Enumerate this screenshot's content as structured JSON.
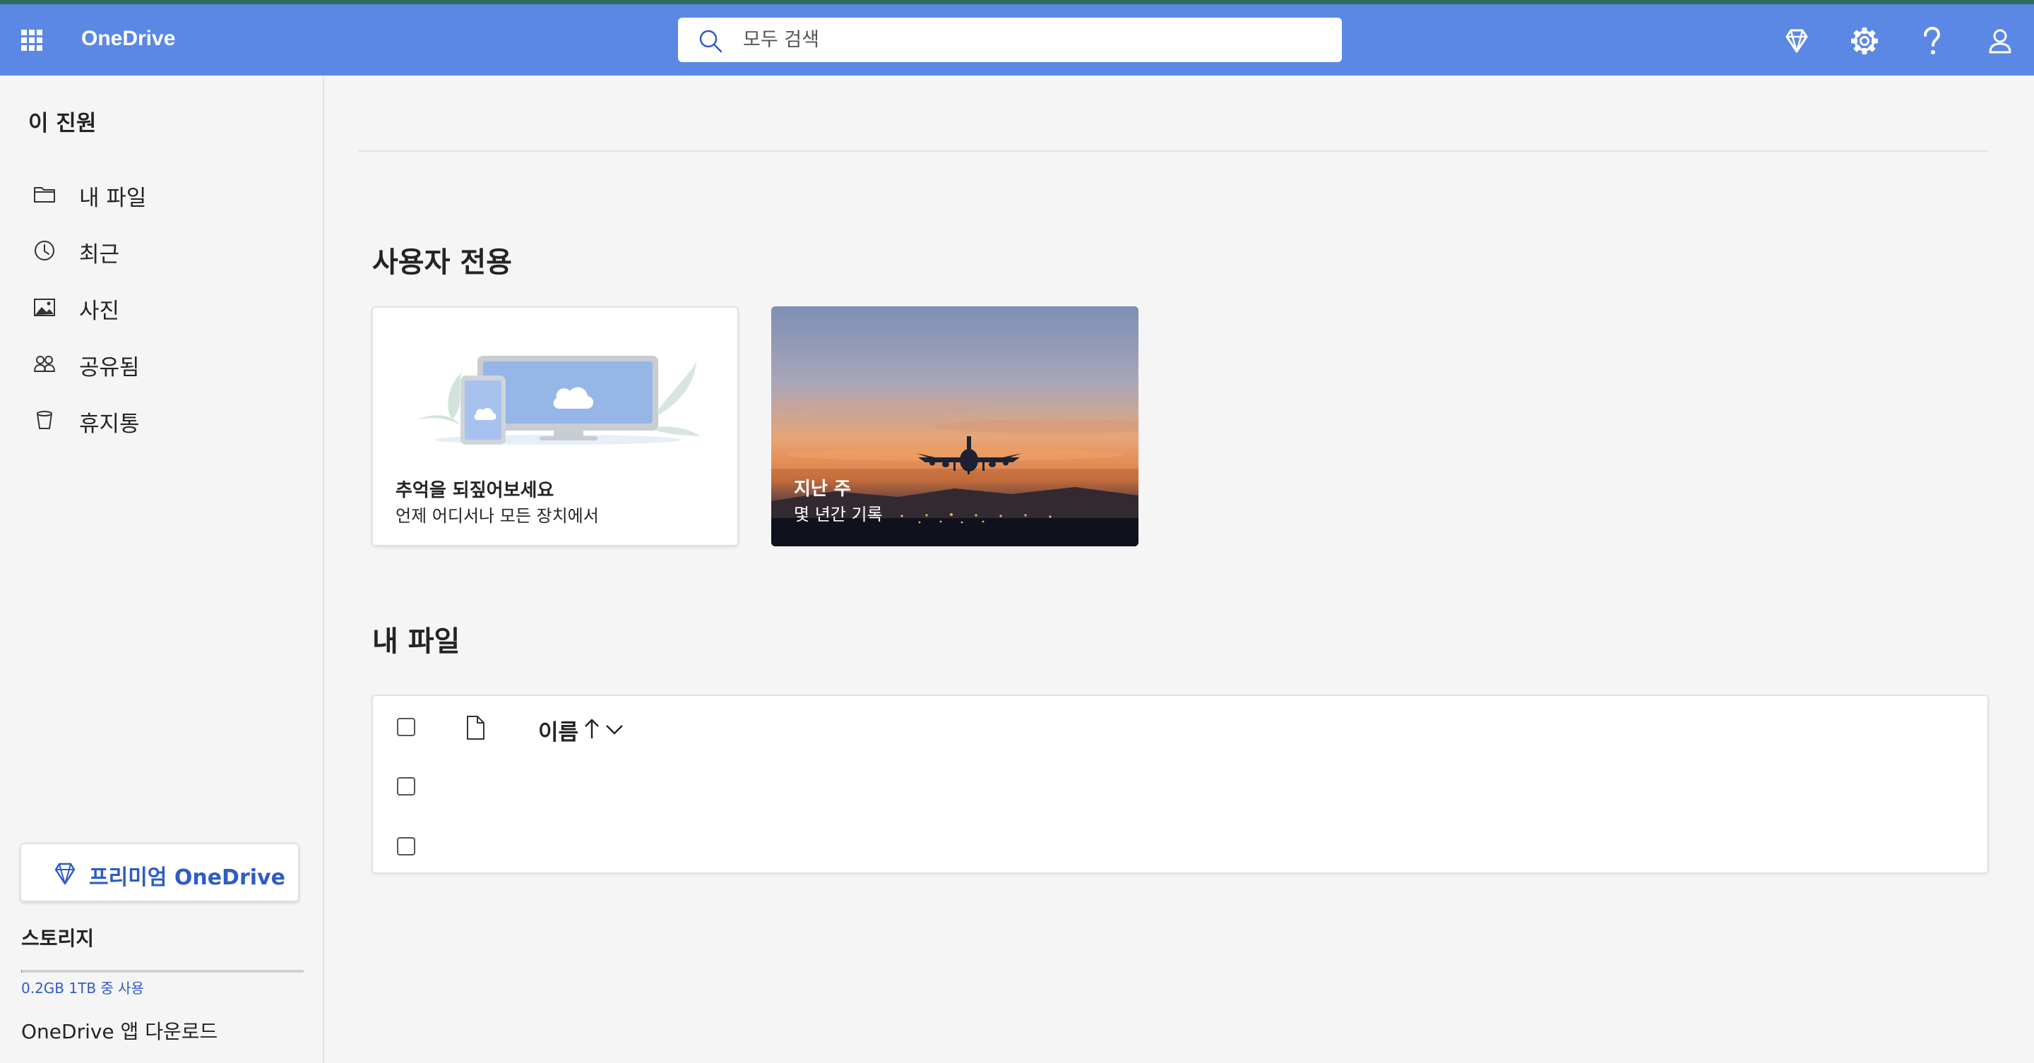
{
  "app": {
    "brand": "OneDrive"
  },
  "search": {
    "placeholder": "모두 검색"
  },
  "sidebar": {
    "user_name": "이 진원",
    "items": [
      {
        "label": "내 파일",
        "icon": "folder-icon"
      },
      {
        "label": "최근",
        "icon": "clock-icon"
      },
      {
        "label": "사진",
        "icon": "image-icon"
      },
      {
        "label": "공유됨",
        "icon": "people-icon"
      },
      {
        "label": "휴지통",
        "icon": "trash-icon"
      }
    ],
    "premium_label": "프리미엄 OneDrive",
    "storage_title": "스토리지",
    "storage_text": "0.2GB 1TB 중 사용",
    "storage_fraction": 0.0002,
    "download_label": "OneDrive 앱 다운로드"
  },
  "main": {
    "for_you_title": "사용자 전용",
    "cards": [
      {
        "title": "추억을 되짚어보세요",
        "subtitle": "언제 어디서나 모든 장치에서"
      },
      {
        "title": "지난 주",
        "subtitle": "몇 년간 기록"
      }
    ],
    "my_files_title": "내 파일",
    "table": {
      "name_header": "이름",
      "sort_arrow": "↑"
    }
  },
  "colors": {
    "header_bg": "#5b88e4",
    "accent": "#2d5cc7"
  }
}
